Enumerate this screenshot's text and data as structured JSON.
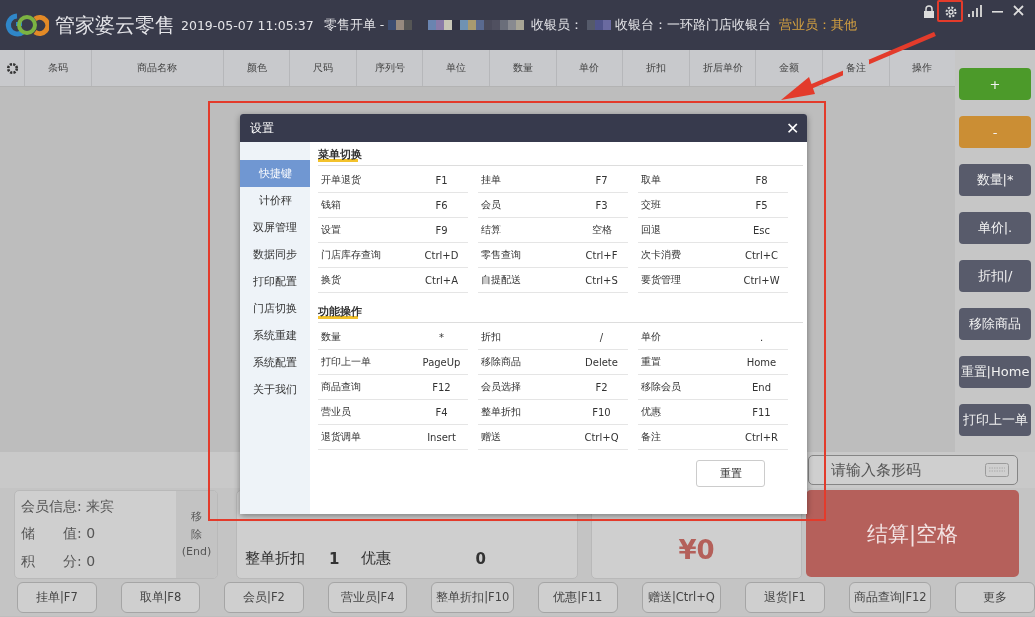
{
  "title_bar": {
    "app_name": "管家婆云零售",
    "datetime": "2019-05-07 11:05:37",
    "order_label": "零售开单 -",
    "cashier_label": "收银员：",
    "register": "收银台：一环路门店收银台",
    "salesperson": "营业员：其他"
  },
  "table": {
    "columns": [
      "条码",
      "商品名称",
      "颜色",
      "尺码",
      "序列号",
      "单位",
      "数量",
      "单价",
      "折扣",
      "折后单价",
      "金额",
      "备注",
      "操作"
    ]
  },
  "side_buttons": [
    {
      "label": "+",
      "kind": "add"
    },
    {
      "label": "-",
      "kind": "subtract"
    },
    {
      "label": "数量|*",
      "kind": "normal"
    },
    {
      "label": "单价|.",
      "kind": "normal"
    },
    {
      "label": "折扣|/",
      "kind": "normal"
    },
    {
      "label": "移除商品",
      "kind": "normal"
    },
    {
      "label": "重置|Home",
      "kind": "normal"
    },
    {
      "label": "打印上一单",
      "kind": "normal"
    }
  ],
  "barcode_field": {
    "placeholder": "请输入条形码"
  },
  "member_panel": {
    "lines": [
      "会员信息: 来宾",
      "储　　值: 0",
      "积　　分: 0"
    ],
    "remove_button": [
      "移",
      "除",
      "(End)"
    ]
  },
  "totals": [
    {
      "label": "整单折扣",
      "value": "1"
    },
    {
      "label": "优惠",
      "value": "0"
    }
  ],
  "amount_due": "¥0",
  "checkout_button": "结算|空格",
  "bottom_buttons": [
    "挂单|F7",
    "取单|F8",
    "会员|F2",
    "营业员|F4",
    "整单折扣|F10",
    "优惠|F11",
    "赠送|Ctrl+Q",
    "退货|F1",
    "商品查询|F12",
    "更多"
  ],
  "dialog": {
    "title": "设置",
    "close": "✕",
    "nav": [
      {
        "label": "快捷键",
        "selected": true
      },
      {
        "label": "计价秤",
        "selected": false
      },
      {
        "label": "双屏管理",
        "selected": false
      },
      {
        "label": "数据同步",
        "selected": false
      },
      {
        "label": "打印配置",
        "selected": false
      },
      {
        "label": "门店切换",
        "selected": false
      },
      {
        "label": "系统重建",
        "selected": false
      },
      {
        "label": "系统配置",
        "selected": false
      },
      {
        "label": "关于我们",
        "selected": false
      }
    ],
    "sections": [
      {
        "heading": "菜单切换",
        "shortcuts": [
          {
            "action": "开单退货",
            "key": "F1"
          },
          {
            "action": "挂单",
            "key": "F7"
          },
          {
            "action": "取单",
            "key": "F8"
          },
          {
            "action": "钱箱",
            "key": "F6"
          },
          {
            "action": "会员",
            "key": "F3"
          },
          {
            "action": "交班",
            "key": "F5"
          },
          {
            "action": "设置",
            "key": "F9"
          },
          {
            "action": "结算",
            "key": "空格"
          },
          {
            "action": "回退",
            "key": "Esc"
          },
          {
            "action": "门店库存查询",
            "key": "Ctrl+D"
          },
          {
            "action": "零售查询",
            "key": "Ctrl+F"
          },
          {
            "action": "次卡消费",
            "key": "Ctrl+C"
          },
          {
            "action": "换货",
            "key": "Ctrl+A"
          },
          {
            "action": "自提配送",
            "key": "Ctrl+S"
          },
          {
            "action": "要货管理",
            "key": "Ctrl+W"
          }
        ]
      },
      {
        "heading": "功能操作",
        "shortcuts": [
          {
            "action": "数量",
            "key": "*"
          },
          {
            "action": "折扣",
            "key": "/"
          },
          {
            "action": "单价",
            "key": "."
          },
          {
            "action": "打印上一单",
            "key": "PageUp"
          },
          {
            "action": "移除商品",
            "key": "Delete"
          },
          {
            "action": "重置",
            "key": "Home"
          },
          {
            "action": "商品查询",
            "key": "F12"
          },
          {
            "action": "会员选择",
            "key": "F2"
          },
          {
            "action": "移除会员",
            "key": "End"
          },
          {
            "action": "营业员",
            "key": "F4"
          },
          {
            "action": "整单折扣",
            "key": "F10"
          },
          {
            "action": "优惠",
            "key": "F11"
          },
          {
            "action": "退货调单",
            "key": "Insert"
          },
          {
            "action": "赠送",
            "key": "Ctrl+Q"
          },
          {
            "action": "备注",
            "key": "Ctrl+R"
          }
        ]
      }
    ],
    "reset_button": "重置"
  }
}
